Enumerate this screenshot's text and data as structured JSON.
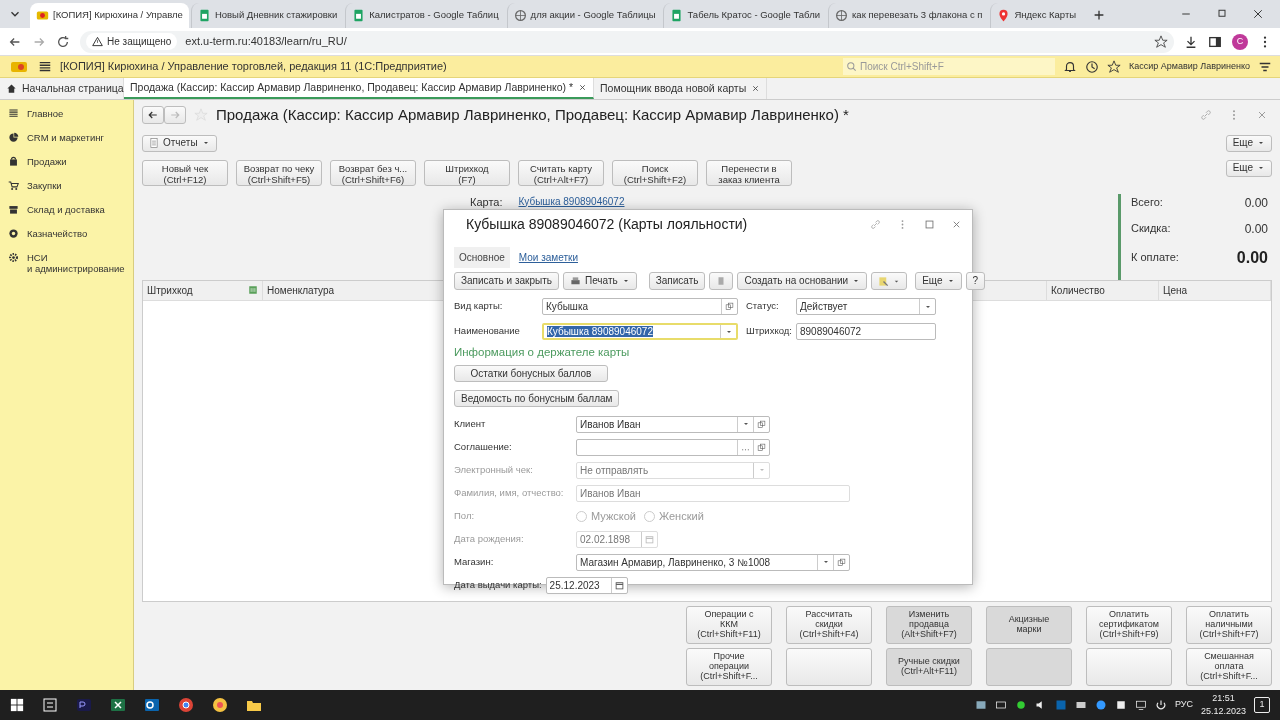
{
  "browser": {
    "tabs": [
      {
        "title": "[КОПИЯ] Кирюхина / Управле",
        "selected": true
      },
      {
        "title": "Новый Дневник стажировки",
        "selected": false
      },
      {
        "title": "Калистратов - Google Таблиц",
        "selected": false
      },
      {
        "title": "для акции - Google Таблицы",
        "selected": false
      },
      {
        "title": "Табель Кратос - Google Табли",
        "selected": false
      },
      {
        "title": "как перевезать 3 флакона с п",
        "selected": false
      },
      {
        "title": "Яндекс Карты",
        "selected": false
      }
    ],
    "security": "Не защищено",
    "url": "ext.u-term.ru:40183/learn/ru_RU/",
    "profile": "C"
  },
  "app": {
    "title": "[КОПИЯ] Кирюхина / Управление торговлей, редакция 11  (1С:Предприятие)",
    "search_placeholder": "Поиск Ctrl+Shift+F",
    "user": "Кассир Армавир Лавриненко",
    "open_tabs": [
      {
        "label": "Начальная страница",
        "selected": false
      },
      {
        "label": "Продажа (Кассир: Кассир Армавир Лавриненко, Продавец: Кассир Армавир Лавриненко) *",
        "selected": true
      },
      {
        "label": "Помощник ввода новой карты",
        "selected": false
      }
    ]
  },
  "sidebar": {
    "items": [
      {
        "label": "Главное"
      },
      {
        "label": "CRM и маркетинг"
      },
      {
        "label": "Продажи"
      },
      {
        "label": "Закупки"
      },
      {
        "label": "Склад и доставка"
      },
      {
        "label": "Казначейство"
      },
      {
        "label": "НСИ\nи администрирование"
      }
    ]
  },
  "document": {
    "title": "Продажа (Кассир: Кассир Армавир Лавриненко, Продавец: Кассир Армавир Лавриненко) *",
    "reports_button": "Отчеты",
    "actions": [
      "Новый чек\n(Ctrl+F12)",
      "Возврат по чеку\n(Ctrl+Shift+F5)",
      "Возврат без ч...\n(Ctrl+Shift+F6)",
      "Штрихкод\n(F7)",
      "Считать карту\n(Ctrl+Alt+F7)",
      "Поиск\n(Ctrl+Shift+F2)",
      "Перенести в\nзаказ клиента"
    ],
    "more_buttons": [
      "Еще",
      "Еще"
    ],
    "card_label": "Карта:",
    "card_link": "Кубышка 89089046072",
    "totals": [
      {
        "label": "Всего:",
        "value": "0.00",
        "emphasis": false
      },
      {
        "label": "Скидка:",
        "value": "0.00",
        "emphasis": false
      },
      {
        "label": "К оплате:",
        "value": "0.00",
        "emphasis": true
      }
    ],
    "table": {
      "columns": [
        "Штрихкод",
        "Номенклатура",
        "Количество",
        "Цена"
      ]
    },
    "bottom_buttons": [
      {
        "label": "Операции с\nККМ\n(Ctrl+Shift+F11)",
        "shaded": false
      },
      {
        "label": "Рассчитать\nскидки\n(Ctrl+Shift+F4)",
        "shaded": false
      },
      {
        "label": "Изменить\nпродавца\n(Alt+Shift+F7)",
        "shaded": true
      },
      {
        "label": "Акцизные\nмарки",
        "shaded": true
      },
      {
        "label": "Оплатить\nсертификатом\n(Ctrl+Shift+F9)",
        "shaded": false
      },
      {
        "label": "Оплатить\nналичными\n(Ctrl+Shift+F7)",
        "shaded": false
      },
      {
        "label": "Прочие\nоперации\n(Ctrl+Shift+F...",
        "shaded": false
      },
      {
        "shaded": false
      },
      {
        "label": "Ручные скидки\n(Ctrl+Alt+F11)",
        "shaded": true
      },
      {
        "shaded": true
      },
      {
        "shaded": false
      },
      {
        "label": "Смешанная\nоплата\n(Ctrl+Shift+F...",
        "shaded": false
      }
    ]
  },
  "dialog": {
    "title": "Кубышка 89089046072 (Карты лояльности)",
    "tabs": [
      {
        "label": "Основное",
        "selected": true
      },
      {
        "label": "Мои заметки",
        "selected": false
      }
    ],
    "toolbar": [
      {
        "kind": "button",
        "label": "Записать и закрыть"
      },
      {
        "kind": "print",
        "label": "Печать"
      },
      {
        "kind": "button",
        "label": "Записать"
      },
      {
        "kind": "icon"
      },
      {
        "kind": "menu",
        "label": "Создать на основании"
      },
      {
        "kind": "iconmenu"
      },
      {
        "kind": "spacer"
      },
      {
        "kind": "menu",
        "label": "Еще"
      },
      {
        "kind": "button",
        "label": "?"
      }
    ],
    "top_fields": [
      {
        "label": "Вид карты:",
        "value": "Кубышка",
        "kind": "open",
        "highlighted": false
      },
      {
        "label": "Статус:",
        "value": "Действует",
        "kind": "select",
        "highlighted": false
      },
      {
        "label": "Наименование",
        "value": "Кубышка 89089046072",
        "kind": "select",
        "highlighted": true
      },
      {
        "label": "Штрихкод:",
        "value": "89089046072",
        "kind": "text",
        "highlighted": false
      }
    ],
    "section_title": "Информация о держателе карты",
    "section_buttons": [
      "Остатки бонусных баллов",
      "Ведомость по бонусным баллам"
    ],
    "fields": [
      {
        "label": "Клиент",
        "value": "Иванов Иван",
        "kind": "select-open",
        "disabled": false
      },
      {
        "label": "Соглашение:",
        "kind": "choose-open",
        "disabled": false
      },
      {
        "label": "Электронный чек:",
        "value": "Не отправлять",
        "kind": "select",
        "disabled": true
      },
      {
        "label": "Фамилия, имя, отчество:",
        "value": "Иванов Иван",
        "kind": "wide",
        "disabled": true
      },
      {
        "label": "Пол:",
        "kind": "radio",
        "disabled": true,
        "options": [
          {
            "label": "Мужской",
            "selected": false
          },
          {
            "label": "Женский",
            "selected": false
          }
        ]
      },
      {
        "label": "Дата рождения:",
        "value": "02.02.1898",
        "kind": "date",
        "disabled": true
      },
      {
        "label": "Магазин:",
        "value": "Магазин Армавир, Лавриненко, 3 №1008",
        "kind": "wide-select",
        "disabled": false
      },
      {
        "label": "Дата выдачи карты:",
        "value": "25.12.2023",
        "kind": "date-inline",
        "disabled": false
      }
    ]
  },
  "taskbar": {
    "language": "РУС",
    "time": "21:51",
    "date": "25.12.2023",
    "notifications": "1"
  }
}
